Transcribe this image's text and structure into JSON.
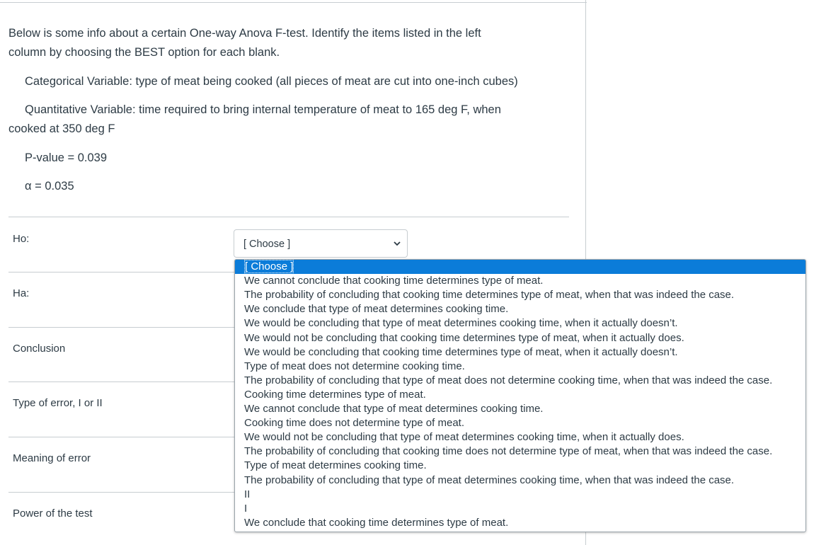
{
  "intro": {
    "line1": "Below is some info about a certain One-way Anova F-test.  Identify the items listed in the left",
    "line2": "column by choosing the BEST option for each blank."
  },
  "info": {
    "categorical": "Categorical Variable: type of meat being cooked (all pieces of meat are cut into one-inch cubes)",
    "quantitative_line1": "Quantitative Variable: time required to bring internal temperature of meat to 165 deg F, when",
    "quantitative_line2": "cooked at 350 deg F",
    "pvalue": "P-value = 0.039",
    "alpha": "α = 0.035"
  },
  "rows": [
    {
      "label": "Ho:"
    },
    {
      "label": "Ha:"
    },
    {
      "label": "Conclusion"
    },
    {
      "label": "Type of error, I or II"
    },
    {
      "label": "Meaning of error"
    },
    {
      "label": "Power of the test"
    }
  ],
  "select": {
    "value": "[ Choose ]",
    "icon": "chevron-down-icon"
  },
  "dropdown": {
    "selected_index": 0,
    "selected_color": "#0b7cd9",
    "options": [
      "[ Choose ]",
      "We cannot conclude that cooking time determines type of meat.",
      "The probability of concluding that cooking time determines type of meat, when that was indeed the case.",
      "We conclude that type of meat determines cooking time.",
      "We would be concluding that type of meat determines cooking time, when it actually doesn’t.",
      "We would not be concluding that cooking time determines type of meat, when it actually does.",
      "We would be concluding that cooking time determines type of meat, when it actually doesn’t.",
      "Type of meat does not determine cooking time.",
      "The probability of concluding that type of meat does not determine cooking time, when that was indeed the case.",
      "Cooking time determines type of meat.",
      "We cannot conclude that type of meat determines cooking time.",
      "Cooking time does not determine type of meat.",
      "We would not be concluding that type of meat determines cooking time, when it actually does.",
      "The probability of concluding that cooking time does not determine type of meat, when that was indeed the case.",
      "Type of meat determines cooking time.",
      "The probability of concluding that type of meat determines cooking time, when that was indeed the case.",
      "II",
      "I",
      "We conclude that cooking time determines type of meat."
    ]
  }
}
